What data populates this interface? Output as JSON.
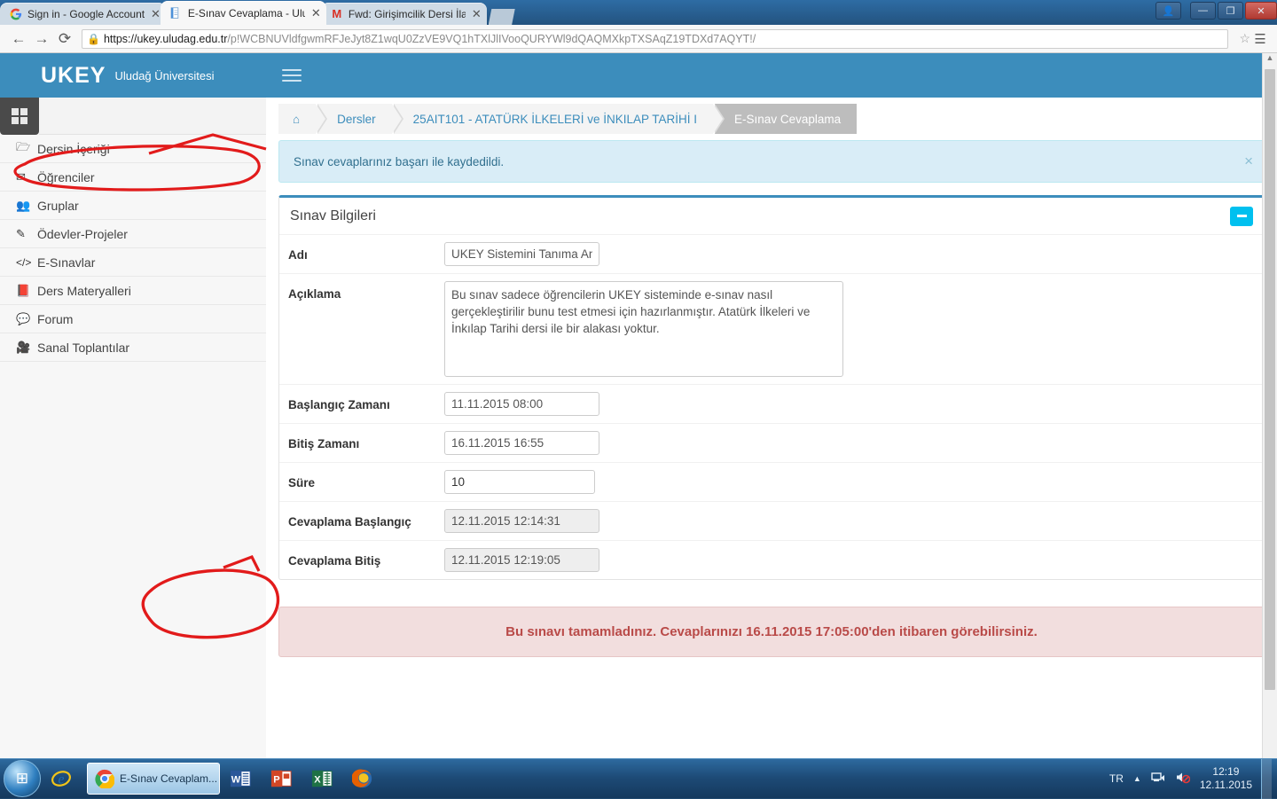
{
  "browser": {
    "tabs": [
      {
        "title": "Sign in - Google Accounts",
        "icon": "google-icon",
        "active": false
      },
      {
        "title": "E-Sınav Cevaplama - Ulud",
        "icon": "page-icon",
        "active": true
      },
      {
        "title": "Fwd: Girişimcilik Dersi İlan",
        "icon": "gmail-icon",
        "active": false
      }
    ],
    "url_host": "https://ukey.uludag.edu.tr",
    "url_path": "/p!WCBNUVldfgwmRFJeJyt8Z1wqU0ZzVE9VQ1hTXlJlIVooQURYWl9dQAQMXkpTXSAqZ19TDXd7AQYT!/",
    "back_label": "←",
    "forward_label": "→",
    "reload_label": "⟳",
    "star_label": "☆",
    "menu_label": "☰",
    "window_controls": {
      "user": "👤",
      "minimize": "—",
      "restore": "❐",
      "close": "✕"
    }
  },
  "app": {
    "logo": "UKEY",
    "logo_subtitle": "Uludağ Üniversitesi",
    "hamburger_label": "menu"
  },
  "sidebar": {
    "grid_tab_label": "grid",
    "items": [
      {
        "label": "Dersin İçeriği",
        "icon": "folder-open-icon"
      },
      {
        "label": "Öğrenciler",
        "icon": "envelope-icon"
      },
      {
        "label": "Gruplar",
        "icon": "users-icon"
      },
      {
        "label": "Ödevler-Projeler",
        "icon": "edit-icon"
      },
      {
        "label": "E-Sınavlar",
        "icon": "code-icon"
      },
      {
        "label": "Ders Materyalleri",
        "icon": "book-icon"
      },
      {
        "label": "Forum",
        "icon": "comment-icon"
      },
      {
        "label": "Sanal Toplantılar",
        "icon": "video-icon"
      }
    ]
  },
  "breadcrumb": [
    {
      "label": "⌂",
      "icon": "home-icon",
      "current": false
    },
    {
      "label": "Dersler",
      "current": false
    },
    {
      "label": "25AIT101 - ATATÜRK İLKELERİ ve İNKILAP TARİHİ I",
      "current": false
    },
    {
      "label": "E-Sınav Cevaplama",
      "current": true
    }
  ],
  "alerts": {
    "success_text": "Sınav cevaplarınız başarı ile kaydedildi.",
    "success_close": "×",
    "danger_text": "Bu sınavı tamamladınız. Cevaplarınızı 16.11.2015 17:05:00'den itibaren görebilirsiniz."
  },
  "panel": {
    "title": "Sınav Bilgileri",
    "collapse_label": "−",
    "fields": [
      {
        "label": "Adı",
        "value": "UKEY Sistemini Tanıma Am",
        "type": "text",
        "readonly": false
      },
      {
        "label": "Açıklama",
        "value": "Bu sınav sadece öğrencilerin UKEY sisteminde e-sınav nasıl gerçekleştirilir bunu test etmesi için hazırlanmıştır. Atatürk İlkeleri ve İnkılap Tarihi dersi ile bir alakası yoktur.",
        "type": "textarea",
        "readonly": false
      },
      {
        "label": "Başlangıç Zamanı",
        "value": "11.11.2015 08:00",
        "type": "text",
        "readonly": false
      },
      {
        "label": "Bitiş Zamanı",
        "value": "16.11.2015 16:55",
        "type": "text",
        "readonly": false
      },
      {
        "label": "Süre",
        "value": "10",
        "type": "number",
        "readonly": false
      },
      {
        "label": "Cevaplama Başlangıç",
        "value": "12.11.2015 12:14:31",
        "type": "text",
        "readonly": true
      },
      {
        "label": "Cevaplama Bitiş",
        "value": "12.11.2015 12:19:05",
        "type": "text",
        "readonly": true
      }
    ]
  },
  "taskbar": {
    "start_label": "⊞",
    "pinned": [
      {
        "name": "internet-explorer-icon",
        "glyph": "e"
      }
    ],
    "active_window": {
      "label": "E-Sınav Cevaplam...",
      "icon": "chrome-icon"
    },
    "apps": [
      {
        "name": "word-icon",
        "glyph": "W",
        "color": "#2b579a"
      },
      {
        "name": "powerpoint-icon",
        "glyph": "P",
        "color": "#d24726"
      },
      {
        "name": "excel-icon",
        "glyph": "X",
        "color": "#1e7145"
      },
      {
        "name": "firefox-icon",
        "glyph": "🦊",
        "color": "#e66000"
      }
    ],
    "tray": {
      "language": "TR",
      "show_hidden": "▲",
      "network": "network-icon",
      "volume": "volume-muted-icon",
      "time": "12:19",
      "date": "12.11.2015"
    }
  },
  "colors": {
    "header_blue": "#3c8dbc",
    "info_bg": "#d9edf7",
    "danger_bg": "#f2dede",
    "danger_text": "#b94a48",
    "collapse_cyan": "#00c0ef",
    "annotation_red": "#e21b1b"
  }
}
